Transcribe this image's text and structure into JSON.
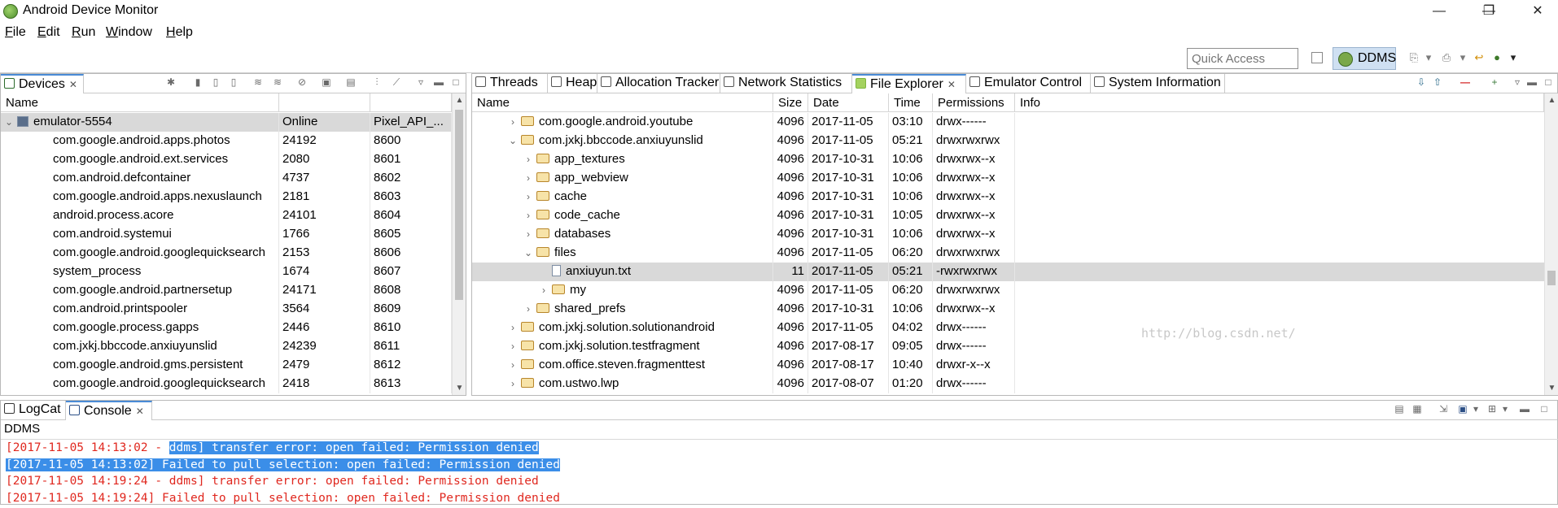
{
  "window": {
    "title": "Android Device Monitor",
    "minimize": "—",
    "restore": "❐",
    "close": "✕"
  },
  "menu": [
    {
      "label": "File",
      "mnemonic": "F",
      "rest": "ile"
    },
    {
      "label": "Edit",
      "mnemonic": "E",
      "rest": "dit"
    },
    {
      "label": "Run",
      "mnemonic": "R",
      "rest": "un"
    },
    {
      "label": "Window",
      "mnemonic": "W",
      "rest": "indow"
    },
    {
      "label": "Help",
      "mnemonic": "H",
      "rest": "elp"
    }
  ],
  "toolbar": {
    "quick_access_placeholder": "Quick Access",
    "perspective": "DDMS"
  },
  "devices": {
    "tab_label": "Devices",
    "columns": [
      "Name",
      "",
      ""
    ],
    "device": {
      "name": "emulator-5554",
      "status": "Online",
      "avd": "Pixel_API_..."
    },
    "processes": [
      {
        "name": "com.google.android.apps.photos",
        "pid": "24192",
        "port": "8600"
      },
      {
        "name": "com.google.android.ext.services",
        "pid": "2080",
        "port": "8601"
      },
      {
        "name": "com.android.defcontainer",
        "pid": "4737",
        "port": "8602"
      },
      {
        "name": "com.google.android.apps.nexuslaunch",
        "pid": "2181",
        "port": "8603"
      },
      {
        "name": "android.process.acore",
        "pid": "24101",
        "port": "8604"
      },
      {
        "name": "com.android.systemui",
        "pid": "1766",
        "port": "8605"
      },
      {
        "name": "com.google.android.googlequicksearch",
        "pid": "2153",
        "port": "8606"
      },
      {
        "name": "system_process",
        "pid": "1674",
        "port": "8607"
      },
      {
        "name": "com.google.android.partnersetup",
        "pid": "24171",
        "port": "8608"
      },
      {
        "name": "com.android.printspooler",
        "pid": "3564",
        "port": "8609"
      },
      {
        "name": "com.google.process.gapps",
        "pid": "2446",
        "port": "8610"
      },
      {
        "name": "com.jxkj.bbccode.anxiuyunslid",
        "pid": "24239",
        "port": "8611"
      },
      {
        "name": "com.google.android.gms.persistent",
        "pid": "2479",
        "port": "8612"
      },
      {
        "name": "com.google.android.googlequicksearch",
        "pid": "2418",
        "port": "8613"
      }
    ]
  },
  "right_tabs": [
    "Threads",
    "Heap",
    "Allocation Tracker",
    "Network Statistics",
    "File Explorer",
    "Emulator Control",
    "System Information"
  ],
  "explorer": {
    "columns": [
      "Name",
      "Size",
      "Date",
      "Time",
      "Permissions",
      "Info"
    ],
    "rows": [
      {
        "name": "com.google.android.youtube",
        "size": "4096",
        "date": "2017-11-05",
        "time": "03:10",
        "perm": "drwx------",
        "indent": 1,
        "expanded": false,
        "type": "folder"
      },
      {
        "name": "com.jxkj.bbccode.anxiuyunslid",
        "size": "4096",
        "date": "2017-11-05",
        "time": "05:21",
        "perm": "drwxrwxrwx",
        "indent": 1,
        "expanded": true,
        "type": "folder"
      },
      {
        "name": "app_textures",
        "size": "4096",
        "date": "2017-10-31",
        "time": "10:06",
        "perm": "drwxrwx--x",
        "indent": 2,
        "expanded": false,
        "type": "folder"
      },
      {
        "name": "app_webview",
        "size": "4096",
        "date": "2017-10-31",
        "time": "10:06",
        "perm": "drwxrwx--x",
        "indent": 2,
        "expanded": false,
        "type": "folder"
      },
      {
        "name": "cache",
        "size": "4096",
        "date": "2017-10-31",
        "time": "10:06",
        "perm": "drwxrwx--x",
        "indent": 2,
        "expanded": false,
        "type": "folder"
      },
      {
        "name": "code_cache",
        "size": "4096",
        "date": "2017-10-31",
        "time": "10:05",
        "perm": "drwxrwx--x",
        "indent": 2,
        "expanded": false,
        "type": "folder"
      },
      {
        "name": "databases",
        "size": "4096",
        "date": "2017-10-31",
        "time": "10:06",
        "perm": "drwxrwx--x",
        "indent": 2,
        "expanded": false,
        "type": "folder"
      },
      {
        "name": "files",
        "size": "4096",
        "date": "2017-11-05",
        "time": "06:20",
        "perm": "drwxrwxrwx",
        "indent": 2,
        "expanded": true,
        "type": "folder"
      },
      {
        "name": "anxiuyun.txt",
        "size": "11",
        "date": "2017-11-05",
        "time": "05:21",
        "perm": "-rwxrwxrwx",
        "indent": 3,
        "expanded": null,
        "type": "file",
        "selected": true
      },
      {
        "name": "my",
        "size": "4096",
        "date": "2017-11-05",
        "time": "06:20",
        "perm": "drwxrwxrwx",
        "indent": 3,
        "expanded": false,
        "type": "folder"
      },
      {
        "name": "shared_prefs",
        "size": "4096",
        "date": "2017-10-31",
        "time": "10:06",
        "perm": "drwxrwx--x",
        "indent": 2,
        "expanded": false,
        "type": "folder"
      },
      {
        "name": "com.jxkj.solution.solutionandroid",
        "size": "4096",
        "date": "2017-11-05",
        "time": "04:02",
        "perm": "drwx------",
        "indent": 1,
        "expanded": false,
        "type": "folder"
      },
      {
        "name": "com.jxkj.solution.testfragment",
        "size": "4096",
        "date": "2017-08-17",
        "time": "09:05",
        "perm": "drwx------",
        "indent": 1,
        "expanded": false,
        "type": "folder"
      },
      {
        "name": "com.office.steven.fragmenttest",
        "size": "4096",
        "date": "2017-08-17",
        "time": "10:40",
        "perm": "drwxr-x--x",
        "indent": 1,
        "expanded": false,
        "type": "folder"
      },
      {
        "name": "com.ustwo.lwp",
        "size": "4096",
        "date": "2017-08-07",
        "time": "01:20",
        "perm": "drwx------",
        "indent": 1,
        "expanded": false,
        "type": "folder"
      }
    ],
    "watermark": "http://blog.csdn.net/"
  },
  "bottom_tabs": [
    "LogCat",
    "Console"
  ],
  "console": {
    "label": "DDMS",
    "lines": [
      {
        "pre": "[2017-11-05 14:13:02 - ",
        "hl": "ddms] transfer error: open failed: Permission denied",
        "post": ""
      },
      {
        "pre": "",
        "hl": "[2017-11-05 14:13:02] Failed to pull selection: open failed: Permission denied",
        "post": ""
      },
      {
        "pre": "[2017-11-05 14:19:24 - ddms] transfer error: open failed: Permission denied",
        "hl": "",
        "post": ""
      },
      {
        "pre": "[2017-11-05 14:19:24] Failed to pull selection: open failed: Permission denied",
        "hl": "",
        "post": ""
      }
    ]
  }
}
